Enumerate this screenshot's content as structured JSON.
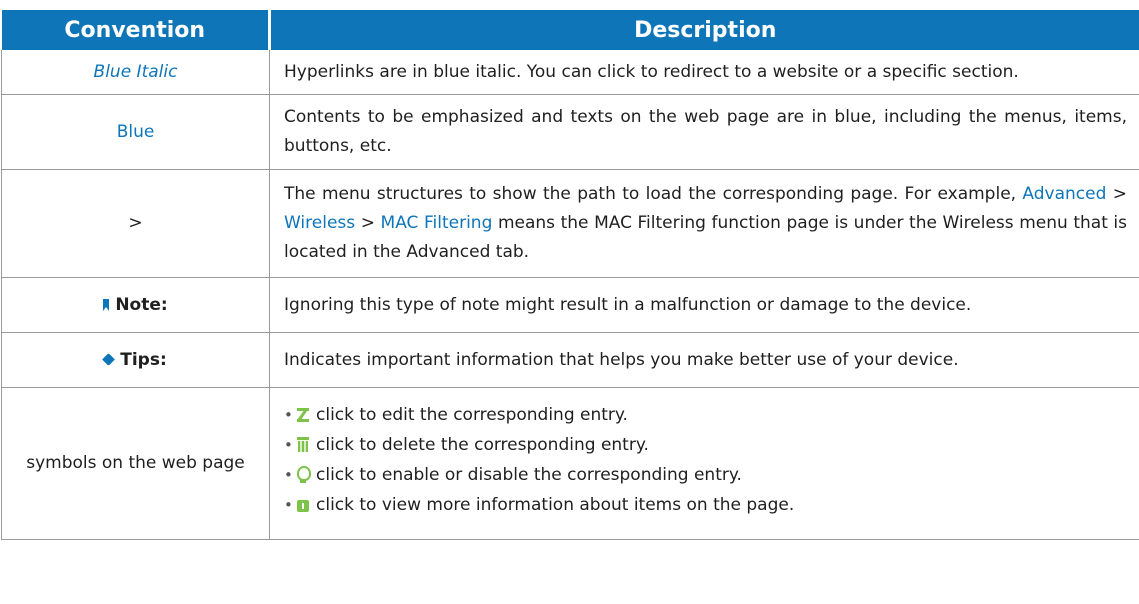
{
  "header": {
    "convention": "Convention",
    "description": "Description"
  },
  "rows": [
    {
      "convention": "Blue Italic",
      "description": "Hyperlinks are in blue italic. You can click to redirect to a website or a specific section."
    },
    {
      "convention": "Blue",
      "description": "Contents to be emphasized and texts on the web page are in blue, including the menus, items, buttons, etc."
    },
    {
      "convention": ">",
      "description_prefix": "The menu structures to show the path to load the corresponding page. For example,",
      "path_1": "Advanced",
      "sep_1": ">",
      "path_2": "Wireless",
      "sep_2": ">",
      "path_3": "MAC Filtering",
      "description_suffix": "means the MAC Filtering function page is under the Wireless menu that is located in the Advanced tab."
    },
    {
      "convention": "Note:",
      "icon": "bookmark-icon",
      "description": "Ignoring this type of note might result in a malfunction or damage to the device."
    },
    {
      "convention": "Tips:",
      "icon": "tag-icon",
      "description": "Indicates important information that helps you make better use of your device."
    },
    {
      "convention": "symbols on the web page",
      "symbols": [
        {
          "icon": "edit-icon",
          "text": "click to edit the corresponding entry."
        },
        {
          "icon": "trash-icon",
          "text": "click to delete the corresponding entry."
        },
        {
          "icon": "lightbulb-icon",
          "text": "click to enable or disable the corresponding entry."
        },
        {
          "icon": "info-icon",
          "text": "click to view more information about items on the page."
        }
      ]
    }
  ],
  "colors": {
    "header_bg": "#0e76b8",
    "link_blue": "#0e76b8",
    "icon_green": "#7fc24a",
    "border": "#9a9a9a"
  }
}
